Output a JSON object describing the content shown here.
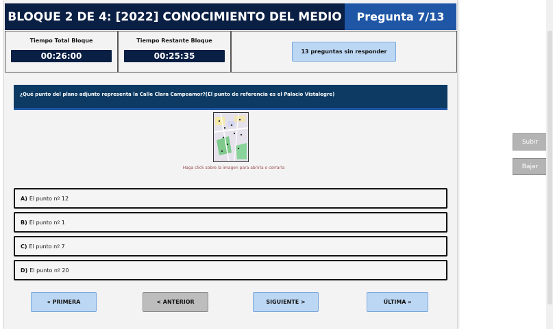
{
  "header": {
    "title": "BLOQUE 2 DE 4: [2022] CONOCIMIENTO DEL MEDIO",
    "progress": "Pregunta 7/13"
  },
  "timers": {
    "total_label": "Tiempo Total Bloque",
    "total_value": "00:26:00",
    "remaining_label": "Tiempo Restante Bloque",
    "remaining_value": "00:25:35"
  },
  "unanswered_label": "13 preguntas sin responder",
  "question": {
    "text": "¿Qué punto del plano adjunto representa la Calle Clara Campoamor?(El punto de referencia es el Palacio Vistalegre)",
    "image_hint": "Haga click sobre la imagen para abrirla o cerrarla"
  },
  "answers": [
    {
      "letter": "A)",
      "text": "El punto nº 12"
    },
    {
      "letter": "B)",
      "text": "El punto nº 1"
    },
    {
      "letter": "C)",
      "text": "El punto nº 7"
    },
    {
      "letter": "D)",
      "text": "El punto nº 20"
    }
  ],
  "nav": {
    "first": "« PRIMERA",
    "previous": "< ANTERIOR",
    "next": "SIGUIENTE >",
    "last": "ÚLTIMA »"
  },
  "side": {
    "up": "Subir",
    "down": "Bajar"
  },
  "colors": {
    "header_dark": "#0a1f44",
    "header_blue": "#1f57a6",
    "button_light": "#bcd7f3",
    "button_disabled": "#bdbdbd"
  }
}
